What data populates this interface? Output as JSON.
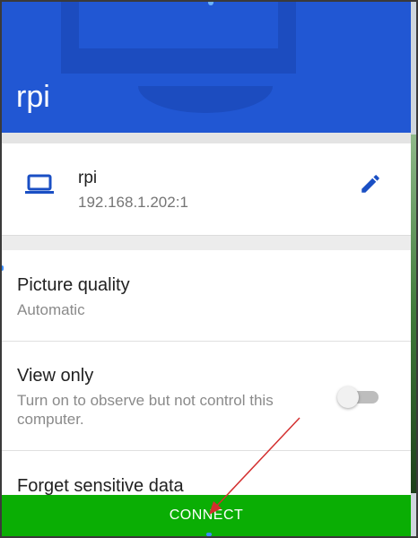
{
  "header": {
    "title": "rpi"
  },
  "device": {
    "icon": "laptop-icon",
    "name": "rpi",
    "address": "192.168.1.202:1",
    "edit_icon": "pencil-icon"
  },
  "settings": [
    {
      "title": "Picture quality",
      "subtitle": "Automatic"
    },
    {
      "title": "View only",
      "subtitle": "Turn on to observe but not control this computer.",
      "toggle_on": false
    },
    {
      "title": "Forget sensitive data"
    }
  ],
  "connect": {
    "label": "CONNECT"
  },
  "colors": {
    "header": "#2157d3",
    "accent_icon": "#1a4fc4",
    "connect_bar": "#0aae04",
    "annotation": "#d32f2f"
  }
}
